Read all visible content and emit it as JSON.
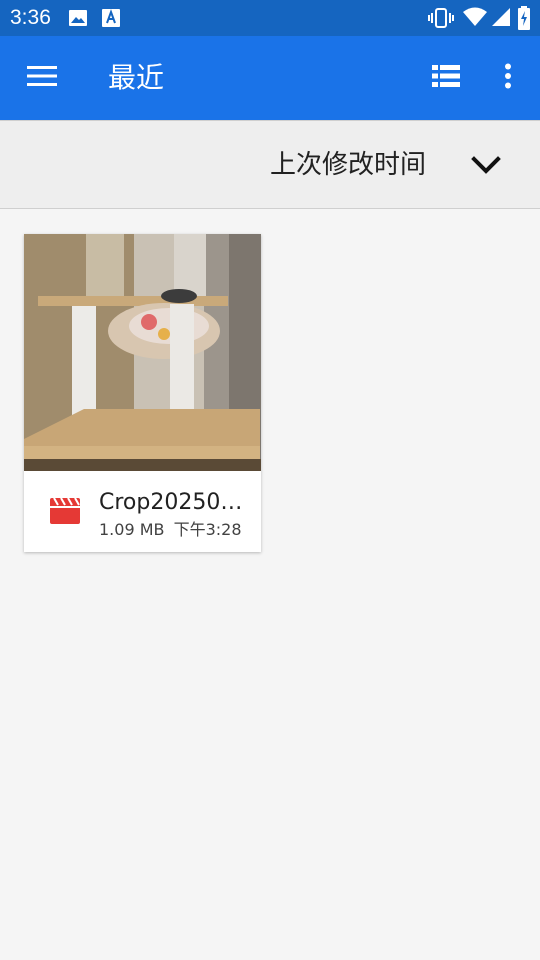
{
  "status_bar": {
    "time": "3:36",
    "icons": [
      "image-icon",
      "text-a-icon",
      "vibrate-icon",
      "wifi-icon",
      "signal-icon",
      "battery-charging-icon"
    ]
  },
  "app_bar": {
    "title": "最近",
    "icons": [
      "menu-icon",
      "list-view-icon",
      "more-vert-icon"
    ]
  },
  "sort_bar": {
    "label": "上次修改时间",
    "icon": "chevron-down-icon"
  },
  "files": [
    {
      "name": "Crop20250…",
      "size": "1.09 MB",
      "time": "下午3:28",
      "type_icon": "video-clapper-icon",
      "type_color": "#e53935"
    }
  ],
  "colors": {
    "status_bar": "#1565c0",
    "app_bar": "#1a73e8",
    "background": "#f5f5f5",
    "sort_bar": "#eeeeee"
  }
}
